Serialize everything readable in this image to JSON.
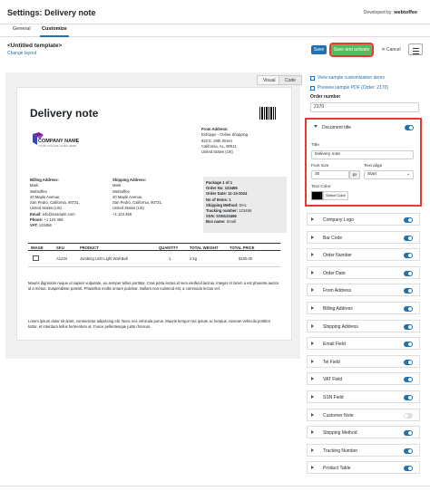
{
  "header": {
    "title": "Settings: Delivery note",
    "developed_by": "Developed by",
    "brand": "webtoffee"
  },
  "tabs": [
    {
      "label": "General"
    },
    {
      "label": "Customize"
    }
  ],
  "template": {
    "name": "<Untitled template>",
    "change_layout": "Change layout"
  },
  "toolbar": {
    "save": "Save",
    "save_activate": "Save and activate",
    "cancel": "Cancel"
  },
  "view_tabs": {
    "visual": "Visual",
    "code": "Code"
  },
  "document": {
    "title": "Delivery note",
    "company_name": "COMPANY NAME",
    "company_tag": "YOUR TAGLINE GOES HERE",
    "from": {
      "label": "From Address:",
      "lines": [
        "Eshoppe - Online Shopping",
        "822 E. 20th Street",
        "California, AL, 90011",
        "United States (US)"
      ]
    },
    "billing": {
      "label": "Billing Address:",
      "lines": [
        "Mark",
        "Webtoffee",
        "20 Maple Avenue,",
        "San Pedro, California, 90731,",
        "United States (US)"
      ],
      "email_label": "Email:",
      "email": "info@example.com",
      "phone_label": "Phone:",
      "phone": "+1 123 456",
      "vat_label": "VAT:",
      "vat": "123456"
    },
    "shipping": {
      "label": "Shipping Address:",
      "lines": [
        "Mark",
        "Webtoffee",
        "20 Maple Avenue,",
        "San Pedro, California, 90731,",
        "United States (US)",
        "+1 123 456"
      ]
    },
    "package": {
      "title": "Package 1 of 1",
      "order_no": "Order No: 123456",
      "order_date": "Order Date: 11-13-2024",
      "no_items": "No of Items: 1",
      "ship_method_label": "Shipping Method:",
      "ship_method": "DHL",
      "tracking_label": "Tracking number:",
      "tracking": "123456",
      "ssn": "SSN: SSN123456",
      "box_label": "Box name:",
      "box": "Small"
    },
    "table": {
      "headers": [
        "IMAGE",
        "SKU",
        "PRODUCT",
        "QUANTITY",
        "TOTAL WEIGHT",
        "TOTAL PRICE"
      ],
      "row": {
        "sku": "A1234",
        "product": "Jumbing LED Light Wall Ball",
        "qty": "1",
        "weight": "2 kg",
        "price": "$100.00"
      }
    },
    "para1": "Mauris dignissim neque ut sapien vulputate, eu semper tellus porttitor. Cras porta lectus id sem eleifend lacinia. Integer et lorem a est pharetra auctor id a metus. Suspendisse potenti. Phasellus mollis ornare pulvinar. Nullam non euismod est, a commodo lectus vel.",
    "para2": "Lorem ipsum dolor sit amet, consectetur adipiscing elit. Nunc nec vehicula purus. Mauris tempor nec ipsum ac tempus. Aenean vehicula porttitor tortor, et interdum tellus fermentum at. Fusce pellentesque justo rhoncus."
  },
  "sidebar": {
    "links": [
      "View sample customization demo",
      "Preview sample PDF (Order: 2170)"
    ],
    "order_number_label": "Order number",
    "order_number": "2170",
    "document_title": {
      "label": "Document title",
      "title_label": "Title",
      "title_value": "Delivery note",
      "font_size_label": "Font size",
      "font_size": "30",
      "unit": "px",
      "text_align_label": "Text align",
      "text_align": "Start",
      "text_color_label": "Text Color",
      "select_color": "Select Color"
    },
    "sections": [
      {
        "label": "Company Logo",
        "on": true
      },
      {
        "label": "Bar Code",
        "on": true
      },
      {
        "label": "Order Number",
        "on": true
      },
      {
        "label": "Order Date",
        "on": true
      },
      {
        "label": "From Address",
        "on": true
      },
      {
        "label": "Billing Address",
        "on": true
      },
      {
        "label": "Shipping Address",
        "on": true
      },
      {
        "label": "Email Field",
        "on": true
      },
      {
        "label": "Tel Field",
        "on": true
      },
      {
        "label": "VAT Field",
        "on": true
      },
      {
        "label": "SSN Field",
        "on": true
      },
      {
        "label": "Customer Note",
        "on": false
      },
      {
        "label": "Shipping Method",
        "on": true
      },
      {
        "label": "Tracking Number",
        "on": true
      },
      {
        "label": "Product Table",
        "on": true
      }
    ]
  }
}
